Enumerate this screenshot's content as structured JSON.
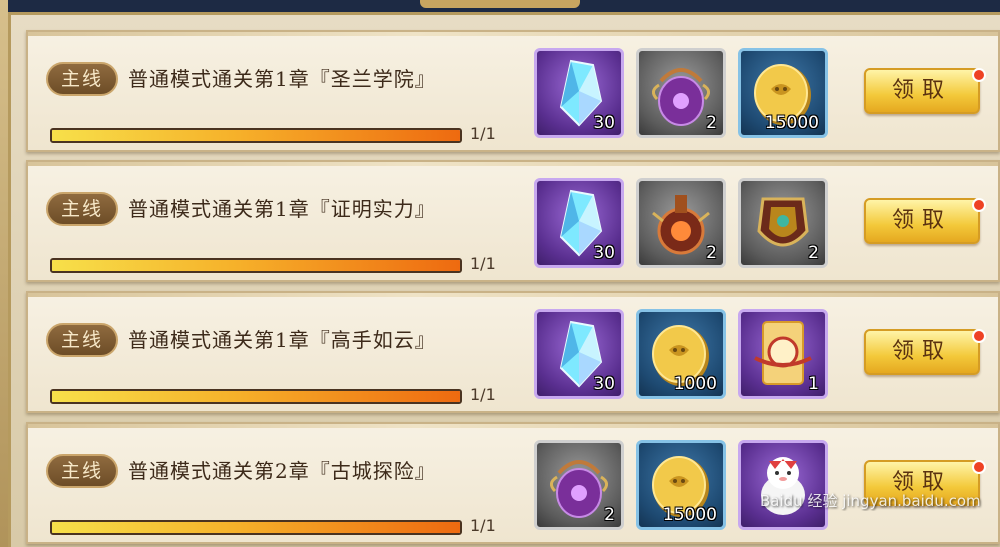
{
  "quests": [
    {
      "tag": "主线",
      "title": "普通模式通关第1章『圣兰学院』",
      "progress_text": "1/1",
      "progress": 1.0,
      "rewards": [
        {
          "icon": "crystal-icon",
          "rarity": "purple",
          "qty": "30"
        },
        {
          "icon": "incense-burner-icon",
          "rarity": "grey",
          "qty": "2"
        },
        {
          "icon": "gold-coin-icon",
          "rarity": "blue",
          "qty": "15000"
        }
      ],
      "claim_label": "领取"
    },
    {
      "tag": "主线",
      "title": "普通模式通关第1章『证明实力』",
      "progress_text": "1/1",
      "progress": 1.0,
      "rewards": [
        {
          "icon": "crystal-icon",
          "rarity": "purple",
          "qty": "30"
        },
        {
          "icon": "potion-gourd-icon",
          "rarity": "grey",
          "qty": "2"
        },
        {
          "icon": "armor-shield-icon",
          "rarity": "grey",
          "qty": "2"
        }
      ],
      "claim_label": "领取"
    },
    {
      "tag": "主线",
      "title": "普通模式通关第1章『高手如云』",
      "progress_text": "1/1",
      "progress": 1.0,
      "rewards": [
        {
          "icon": "crystal-icon",
          "rarity": "purple",
          "qty": "30"
        },
        {
          "icon": "gold-coin-icon",
          "rarity": "blue",
          "qty": "1000"
        },
        {
          "icon": "talisman-scroll-icon",
          "rarity": "purple",
          "qty": "1"
        }
      ],
      "claim_label": "领取"
    },
    {
      "tag": "主线",
      "title": "普通模式通关第2章『古城探险』",
      "progress_text": "1/1",
      "progress": 1.0,
      "rewards": [
        {
          "icon": "incense-burner-icon",
          "rarity": "grey",
          "qty": "2"
        },
        {
          "icon": "gold-coin-icon",
          "rarity": "blue",
          "qty": "15000"
        },
        {
          "icon": "spirit-pet-icon",
          "rarity": "purple",
          "qty": ""
        }
      ],
      "claim_label": "领取"
    }
  ],
  "watermark": "Baidu 经验 jingyan.baidu.com",
  "colors": {
    "claim_button": "#f3c93a",
    "progress_start": "#f7e04a",
    "progress_end": "#ee6a10",
    "notification_dot": "#ee4224",
    "tag_bg": "#7c5a32"
  }
}
